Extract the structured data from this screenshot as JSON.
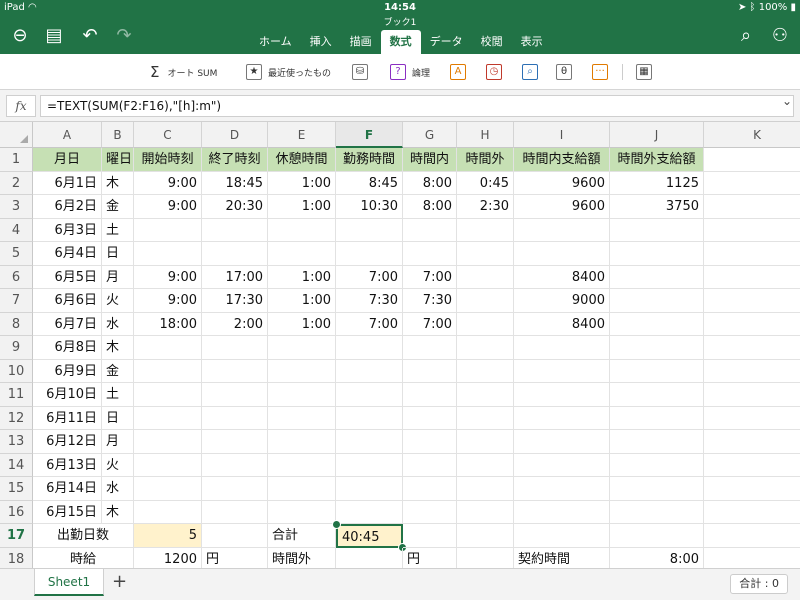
{
  "status": {
    "device": "iPad",
    "time": "14:54",
    "battery": "100%"
  },
  "title": "ブック1",
  "tabs": [
    {
      "label": "ホーム"
    },
    {
      "label": "挿入"
    },
    {
      "label": "描画"
    },
    {
      "label": "数式",
      "active": true
    },
    {
      "label": "データ"
    },
    {
      "label": "校閲"
    },
    {
      "label": "表示"
    }
  ],
  "ribbon": {
    "autosum": "オート SUM",
    "recent": "最近使ったもの",
    "logical": "論理"
  },
  "formula_bar": {
    "fx_label": "fx",
    "formula": "=TEXT(SUM(F2:F16),\"[h]:m\")"
  },
  "columns": [
    "A",
    "B",
    "C",
    "D",
    "E",
    "F",
    "G",
    "H",
    "I",
    "J",
    "K"
  ],
  "rows": [
    {
      "n": "1",
      "cells": [
        "月日",
        "曜日",
        "開始時刻",
        "終了時刻",
        "休憩時間",
        "勤務時間",
        "時間内",
        "時間外",
        "時間内支給額",
        "時間外支給額",
        ""
      ]
    },
    {
      "n": "2",
      "cells": [
        "6月1日",
        "木",
        "9:00",
        "18:45",
        "1:00",
        "8:45",
        "8:00",
        "0:45",
        "9600",
        "1125",
        ""
      ]
    },
    {
      "n": "3",
      "cells": [
        "6月2日",
        "金",
        "9:00",
        "20:30",
        "1:00",
        "10:30",
        "8:00",
        "2:30",
        "9600",
        "3750",
        ""
      ]
    },
    {
      "n": "4",
      "cells": [
        "6月3日",
        "土",
        "",
        "",
        "",
        "",
        "",
        "",
        "",
        "",
        ""
      ]
    },
    {
      "n": "5",
      "cells": [
        "6月4日",
        "日",
        "",
        "",
        "",
        "",
        "",
        "",
        "",
        "",
        ""
      ]
    },
    {
      "n": "6",
      "cells": [
        "6月5日",
        "月",
        "9:00",
        "17:00",
        "1:00",
        "7:00",
        "7:00",
        "",
        "8400",
        "",
        ""
      ]
    },
    {
      "n": "7",
      "cells": [
        "6月6日",
        "火",
        "9:00",
        "17:30",
        "1:00",
        "7:30",
        "7:30",
        "",
        "9000",
        "",
        ""
      ]
    },
    {
      "n": "8",
      "cells": [
        "6月7日",
        "水",
        "18:00",
        "2:00",
        "1:00",
        "7:00",
        "7:00",
        "",
        "8400",
        "",
        ""
      ]
    },
    {
      "n": "9",
      "cells": [
        "6月8日",
        "木",
        "",
        "",
        "",
        "",
        "",
        "",
        "",
        "",
        ""
      ]
    },
    {
      "n": "10",
      "cells": [
        "6月9日",
        "金",
        "",
        "",
        "",
        "",
        "",
        "",
        "",
        "",
        ""
      ]
    },
    {
      "n": "11",
      "cells": [
        "6月10日",
        "土",
        "",
        "",
        "",
        "",
        "",
        "",
        "",
        "",
        ""
      ]
    },
    {
      "n": "12",
      "cells": [
        "6月11日",
        "日",
        "",
        "",
        "",
        "",
        "",
        "",
        "",
        "",
        ""
      ]
    },
    {
      "n": "13",
      "cells": [
        "6月12日",
        "月",
        "",
        "",
        "",
        "",
        "",
        "",
        "",
        "",
        ""
      ]
    },
    {
      "n": "14",
      "cells": [
        "6月13日",
        "火",
        "",
        "",
        "",
        "",
        "",
        "",
        "",
        "",
        ""
      ]
    },
    {
      "n": "15",
      "cells": [
        "6月14日",
        "水",
        "",
        "",
        "",
        "",
        "",
        "",
        "",
        "",
        ""
      ]
    },
    {
      "n": "16",
      "cells": [
        "6月15日",
        "木",
        "",
        "",
        "",
        "",
        "",
        "",
        "",
        "",
        ""
      ]
    },
    {
      "n": "17",
      "cells": [
        "出勤日数",
        "",
        "5",
        "",
        "合計",
        "40:45",
        "",
        "",
        "",
        "",
        ""
      ]
    },
    {
      "n": "18",
      "cells": [
        "時給",
        "",
        "1200",
        "円",
        "時間外",
        "",
        "円",
        "",
        "契約時間",
        "8:00",
        ""
      ]
    }
  ],
  "selected_cell": "F17",
  "sheet_tab": "Sheet1",
  "sum_status": "合計 : 0",
  "colors": {
    "accent": "#217346",
    "header_fill": "#c6e0b4",
    "highlight_fill": "#fff2cc"
  }
}
